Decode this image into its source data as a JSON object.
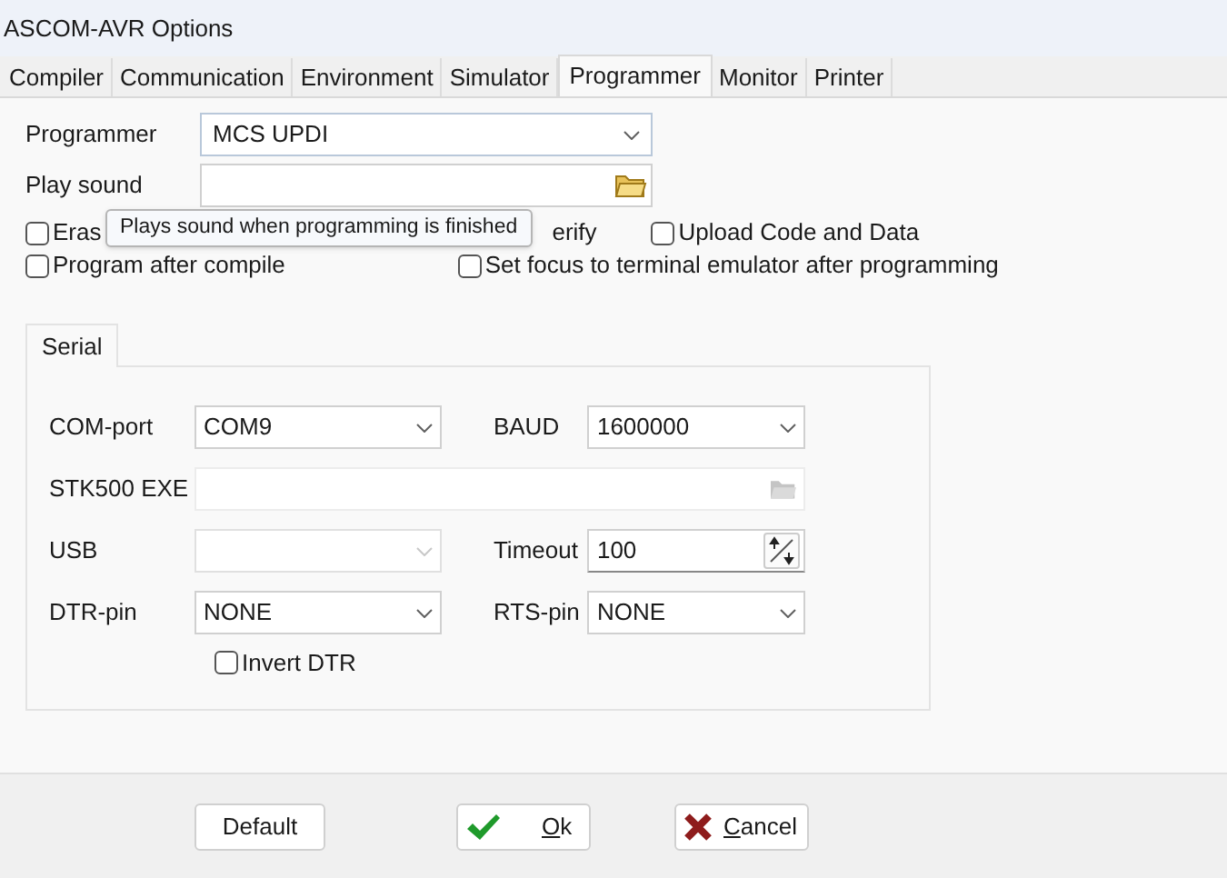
{
  "window": {
    "title": "ASCOM-AVR Options"
  },
  "tabs": [
    {
      "label": "Compiler",
      "selected": false
    },
    {
      "label": "Communication",
      "selected": false
    },
    {
      "label": "Environment",
      "selected": false
    },
    {
      "label": "Simulator",
      "selected": false
    },
    {
      "label": "Programmer",
      "selected": true
    },
    {
      "label": "Monitor",
      "selected": false
    },
    {
      "label": "Printer",
      "selected": false
    }
  ],
  "programmer": {
    "label": "Programmer",
    "value": "MCS UPDI"
  },
  "play_sound": {
    "label": "Play sound"
  },
  "tooltip": "Plays sound when programming is finished",
  "options_row_1": {
    "first": {
      "label": "Eras",
      "checked": false
    },
    "covered_text": "erify",
    "last": {
      "label": "Upload Code and Data",
      "checked": false
    }
  },
  "options_row_2": [
    {
      "label": "Program after compile",
      "checked": false
    },
    {
      "label": "Set focus to terminal emulator after programming",
      "checked": false
    }
  ],
  "subtabs": [
    {
      "label": "Serial",
      "selected": true
    }
  ],
  "serial": {
    "com_port": {
      "label": "COM-port",
      "value": "COM9"
    },
    "baud": {
      "label": "BAUD",
      "value": "1600000"
    },
    "stk500": {
      "label": "STK500 EXE",
      "disabled": true
    },
    "usb": {
      "label": "USB",
      "disabled": true
    },
    "timeout": {
      "label": "Timeout",
      "value": "100"
    },
    "dtr": {
      "label": "DTR-pin",
      "value": "NONE"
    },
    "rts": {
      "label": "RTS-pin",
      "value": "NONE"
    },
    "invert_dtr": {
      "label": "Invert DTR",
      "checked": false
    }
  },
  "buttons": [
    {
      "kind": "plain",
      "label": "Default"
    },
    {
      "kind": "ok",
      "label": "Ok"
    },
    {
      "kind": "cancel",
      "label": "Cancel"
    }
  ]
}
